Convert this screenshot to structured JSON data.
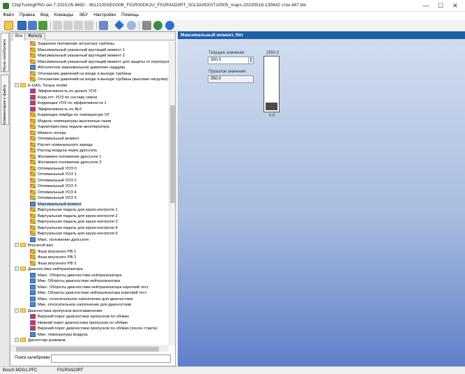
{
  "window": {
    "title": "ChipTuningPRO ver.7.2023.05.4692 - 3612100XEG00B_F01R00DK2U_F01R0AD3RT_S013A05XST10005_maps-20230518-135842 сток 847.bin",
    "minimize_glyph": "—",
    "maximize_glyph": "☐",
    "close_glyph": "✕"
  },
  "menu": [
    "Файл",
    "Правка",
    "Вид",
    "Команды",
    "ЭБУ",
    "Настройки",
    "Помощь"
  ],
  "side_tabs": [
    "Меню калибровок",
    "Комментарии к файлу"
  ],
  "left_tabs": [
    "Все",
    "Фильтр"
  ],
  "tree": [
    {
      "level": 2,
      "icon": "map",
      "label": "Заданное положение актуатора турбины"
    },
    {
      "level": 2,
      "icon": "map",
      "label": "Максимальный указанный крутящий момент 1"
    },
    {
      "level": 2,
      "icon": "map",
      "label": "Максимальный указанный крутящий момент 2"
    },
    {
      "level": 2,
      "icon": "map",
      "label": "Максимальный указанный крутящий момент для защиты от перегрузк"
    },
    {
      "level": 2,
      "icon": "val",
      "label": "Абсолютное максимальное давление наддува"
    },
    {
      "level": 2,
      "icon": "map",
      "label": "Отношение давлений на входе и выходе турбины"
    },
    {
      "level": 2,
      "icon": "map",
      "label": "Отношение давлений на входе и выходе турбины (высокие нагрузки)"
    },
    {
      "level": 1,
      "icon": "folder",
      "expander": "−",
      "label": "E-GAS, Torque model"
    },
    {
      "level": 2,
      "icon": "curve",
      "label": "Эффективность по дельте УОЗ"
    },
    {
      "level": 2,
      "icon": "curve",
      "label": "Корр.отт. УОЗ по составу смеси"
    },
    {
      "level": 2,
      "icon": "curve",
      "label": "Коррекция УОЗ по эффективности 1"
    },
    {
      "level": 2,
      "icon": "curve",
      "label": "Эффективность по ALF"
    },
    {
      "level": 2,
      "icon": "map",
      "label": "Коррекция лямбда по температуре ОГ"
    },
    {
      "level": 2,
      "icon": "map",
      "label": "Модель температуры выхлопных газов"
    },
    {
      "level": 2,
      "icon": "map",
      "label": "Характеристика педали акселератора"
    },
    {
      "level": 2,
      "icon": "map",
      "label": "Момент потерь"
    },
    {
      "level": 2,
      "icon": "map",
      "label": "Оптимальный момент"
    },
    {
      "level": 2,
      "icon": "map",
      "label": "Расчет номинального заряда"
    },
    {
      "level": 2,
      "icon": "map",
      "label": "Расход воздуха через дроссель"
    },
    {
      "level": 2,
      "icon": "map",
      "label": "Желаемое положение дросселя 1"
    },
    {
      "level": 2,
      "icon": "map",
      "label": "Желаемое положение дросселя 2"
    },
    {
      "level": 2,
      "icon": "map",
      "label": "Оптимальный УОЗ 0"
    },
    {
      "level": 2,
      "icon": "map",
      "label": "Оптимальный УОЗ 1"
    },
    {
      "level": 2,
      "icon": "map",
      "label": "Оптимальный УОЗ 2"
    },
    {
      "level": 2,
      "icon": "map",
      "label": "Оптимальный УОЗ 3"
    },
    {
      "level": 2,
      "icon": "map",
      "label": "Оптимальный УОЗ 4"
    },
    {
      "level": 2,
      "icon": "map",
      "label": "Оптимальный УОЗ 5"
    },
    {
      "level": 2,
      "icon": "val",
      "label": "Максимальный момент",
      "selected": true
    },
    {
      "level": 2,
      "icon": "map",
      "label": "Виртуальная педаль для круиз-контроля 1"
    },
    {
      "level": 2,
      "icon": "map",
      "label": "Виртуальная педаль для круиз-контроля 2"
    },
    {
      "level": 2,
      "icon": "map",
      "label": "Виртуальная педаль для круиз-контроля 3"
    },
    {
      "level": 2,
      "icon": "map",
      "label": "Виртуальная педаль для круиз-контроля 4"
    },
    {
      "level": 2,
      "icon": "map",
      "label": "Виртуальная педаль для круиз-контроля 5"
    },
    {
      "level": 2,
      "icon": "val",
      "label": "Макс. положение дросселя"
    },
    {
      "level": 1,
      "icon": "folder",
      "expander": "−",
      "label": "Впускной вал"
    },
    {
      "level": 2,
      "icon": "map",
      "label": "Фаза впускного РВ 1"
    },
    {
      "level": 2,
      "icon": "map",
      "label": "Фаза впускного РВ 2"
    },
    {
      "level": 2,
      "icon": "map",
      "label": "Фаза впускного РВ 3"
    },
    {
      "level": 1,
      "icon": "folder",
      "expander": "−",
      "label": "Диагностика нейтрализатора"
    },
    {
      "level": 2,
      "icon": "val",
      "label": "Макс. Обороты диагностики нейтрализатора"
    },
    {
      "level": 2,
      "icon": "val",
      "label": "Мин. Обороты диагностики нейтрализатора"
    },
    {
      "level": 2,
      "icon": "val",
      "label": "Макс. Обороты диагностики нейтрализатора короткий тест"
    },
    {
      "level": 2,
      "icon": "val",
      "label": "Мин. Обороты диагностики нейтрализатора короткий тест"
    },
    {
      "level": 2,
      "icon": "val",
      "label": "Макс. относительное наполнение для диагностики"
    },
    {
      "level": 2,
      "icon": "val",
      "label": "Мин. относительное наполнение для диагностики"
    },
    {
      "level": 1,
      "icon": "folder",
      "expander": "−",
      "label": "Диагностика пропусков воспламенения"
    },
    {
      "level": 2,
      "icon": "curve",
      "label": "Верхний порог диагностики пропусков по об/мин"
    },
    {
      "level": 2,
      "icon": "curve",
      "label": "Нижний порог диагностики пропусков по об/мин"
    },
    {
      "level": 2,
      "icon": "curve",
      "label": "Верхний порог диагностики пропусков по об/мин (после старта)"
    },
    {
      "level": 2,
      "icon": "val",
      "label": "Мин. температура воздуха"
    },
    {
      "level": 1,
      "icon": "folder",
      "expander": "−",
      "label": "Диспетчер режимов"
    }
  ],
  "search": {
    "label": "Поиск калибровки",
    "value": "",
    "icon": "magnifier-icon"
  },
  "editor": {
    "header": "Максимальный момент, Nm",
    "current_label": "Текущее значение",
    "current_value": "350,0",
    "previous_label": "Прошлое значение",
    "previous_value": "350,0",
    "gauge_max": "2550,0",
    "gauge_min": "0,0",
    "gauge_fraction": 0.137
  },
  "status": {
    "ecu": "Bosch MDG1.PFC",
    "sw": "F01R0AD3RT"
  },
  "colors": {
    "header_bg": "#2060a8",
    "selection": "#cce4f7"
  }
}
